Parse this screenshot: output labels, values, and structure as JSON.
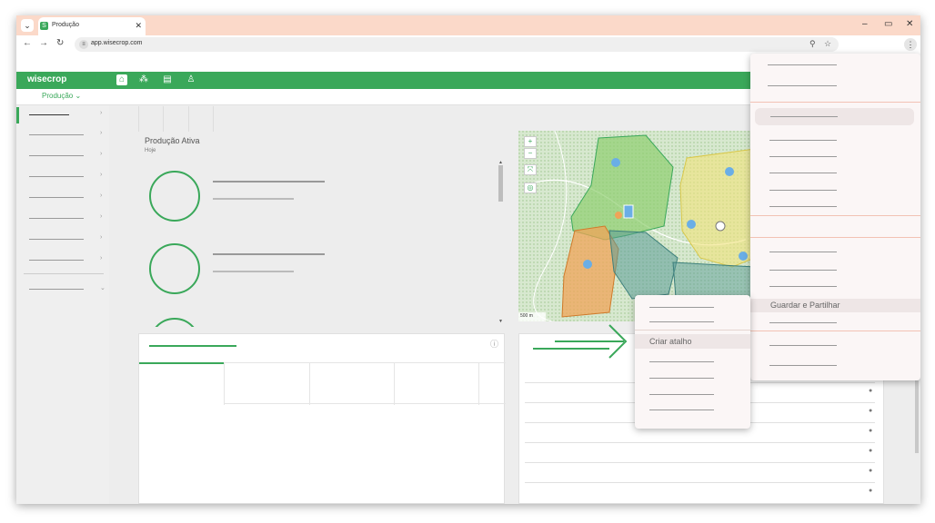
{
  "browser": {
    "tab_title": "Produção",
    "url": "app.wisecrop.com",
    "win_min": "–",
    "win_max": "▭",
    "win_close": "✕"
  },
  "app": {
    "logo": "wisecrop",
    "module_selector": "Produção ⌄",
    "panel_title": "Produção Ativa",
    "panel_subtitle": "Hoje",
    "map_scale": "500 m"
  },
  "context_menu": {
    "highlighted_item": "Guardar e Partilhar"
  },
  "submenu": {
    "highlighted_item": "Criar atalho"
  },
  "colors": {
    "brand_green": "#3aa85a",
    "tabstrip": "#fbd9c9",
    "menu_separator": "#f2c2b4"
  }
}
